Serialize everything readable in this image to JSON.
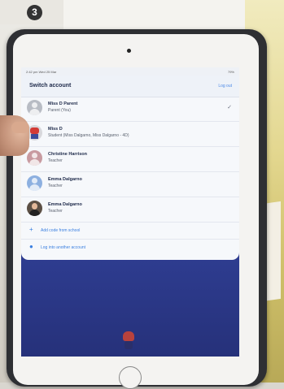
{
  "step_badge": "3",
  "status_bar": {
    "time": "2:42 pm  Wed 25 Mar",
    "battery": "79%"
  },
  "switch_account": {
    "title": "Switch account",
    "log_out": "Log out",
    "accounts": [
      {
        "name": "Miss D Parent",
        "role": "Parent (You)",
        "avatar": "person-icon",
        "selected": true
      },
      {
        "name": "Miss D",
        "role": "Student (Miss Dalgarno, Miss Dalgarno - 4D)",
        "avatar": "robot-avatar-icon",
        "selected": false
      },
      {
        "name": "Christine Harrison",
        "role": "Teacher",
        "avatar": "person-icon",
        "selected": false
      },
      {
        "name": "Emma Dalgarno",
        "role": "Teacher",
        "avatar": "person-icon",
        "selected": false
      },
      {
        "name": "Emma Dalgarno",
        "role": "Teacher",
        "avatar": "photo-avatar",
        "selected": false
      }
    ],
    "actions": [
      {
        "label": "Add code from school",
        "icon": "plus-icon"
      },
      {
        "label": "Log into another account",
        "icon": "person-icon"
      }
    ],
    "check_icon": "✓"
  },
  "colors": {
    "accent": "#3a7fe0",
    "screen_background": "#2e3b8e",
    "sheet_background": "#f6f8fb"
  }
}
